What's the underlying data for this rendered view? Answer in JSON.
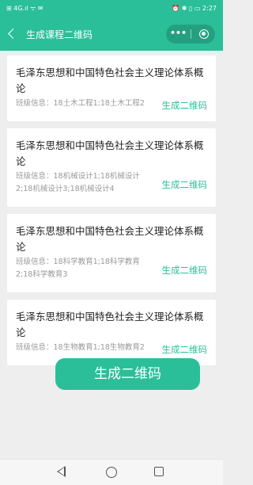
{
  "status_bar": {
    "left": "⊞ 4G.ıl ᯤ ✉",
    "right": "⏰ ✱ ▯ ▭ 2:27"
  },
  "header": {
    "title": "生成课程二维码",
    "capsule_dots": "•••"
  },
  "courses": [
    {
      "course_name": "毛泽东思想和中国特色社会主义理论体系概论",
      "class_info": "班级信息：18土木工程1;18土木工程2",
      "generate_label": "生成二维码"
    },
    {
      "course_name": "毛泽东思想和中国特色社会主义理论体系概论",
      "class_info": "班级信息：18机械设计1;18机械设计2;18机械设计3;18机械设计4",
      "generate_label": "生成二维码"
    },
    {
      "course_name": "毛泽东思想和中国特色社会主义理论体系概论",
      "class_info": "班级信息：18科学教育1;18科学教育2;18科学教育3",
      "generate_label": "生成二维码"
    },
    {
      "course_name": "毛泽东思想和中国特色社会主义理论体系概论",
      "class_info": "班级信息：18生物教育1;18生物教育2",
      "generate_label": "生成二维码"
    }
  ],
  "floating_button": {
    "label": "生成二维码"
  },
  "colors": {
    "accent": "#2bbf99",
    "background": "#eeeeee",
    "card": "#ffffff",
    "muted_text": "#999999"
  }
}
